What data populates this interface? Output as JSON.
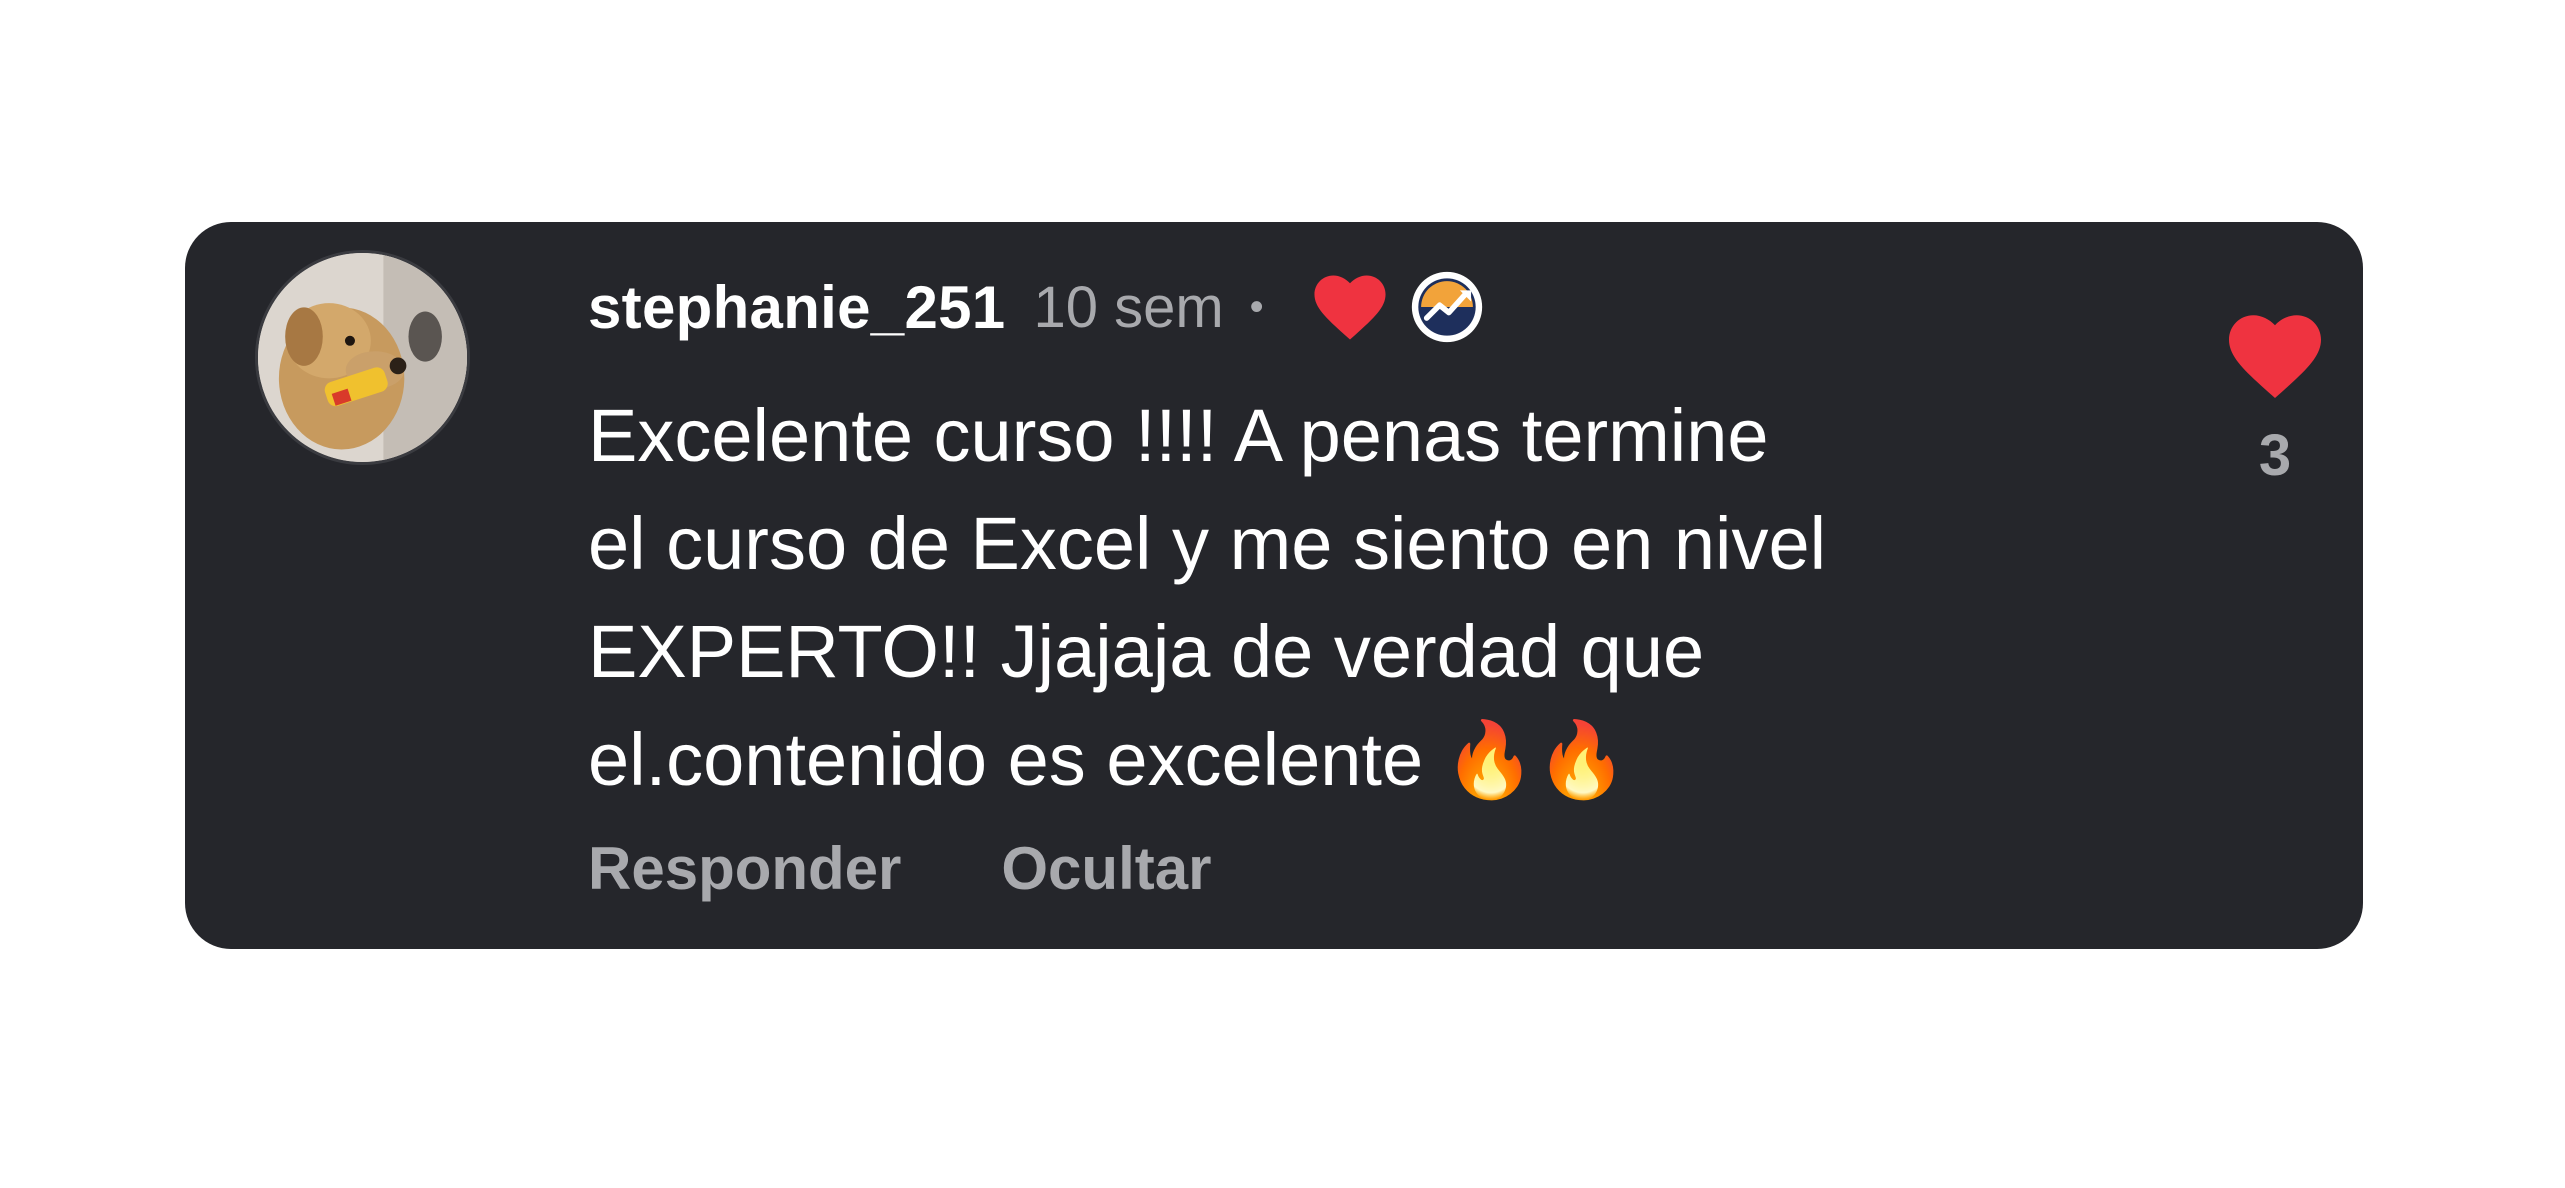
{
  "comment": {
    "username": "stephanie_251",
    "timestamp": "10 sem",
    "separator": "•",
    "text": "Excelente curso !!!! A penas termine\nel curso de Excel y me siento en nivel\nEXPERTO!! Jjajaja de verdad que\nel.contenido es excelente 🔥🔥",
    "avatar_icon": "dog-avatar-icon",
    "creator_liked_icon": "heart-icon",
    "badge_icon": "trend-badge-icon"
  },
  "actions": {
    "reply_label": "Responder",
    "hide_label": "Ocultar"
  },
  "like": {
    "icon": "heart-icon",
    "count": "3"
  },
  "colors": {
    "card_bg": "#25262b",
    "text_primary": "#ffffff",
    "text_secondary": "#a8a9ad",
    "heart": "#ef3340"
  }
}
